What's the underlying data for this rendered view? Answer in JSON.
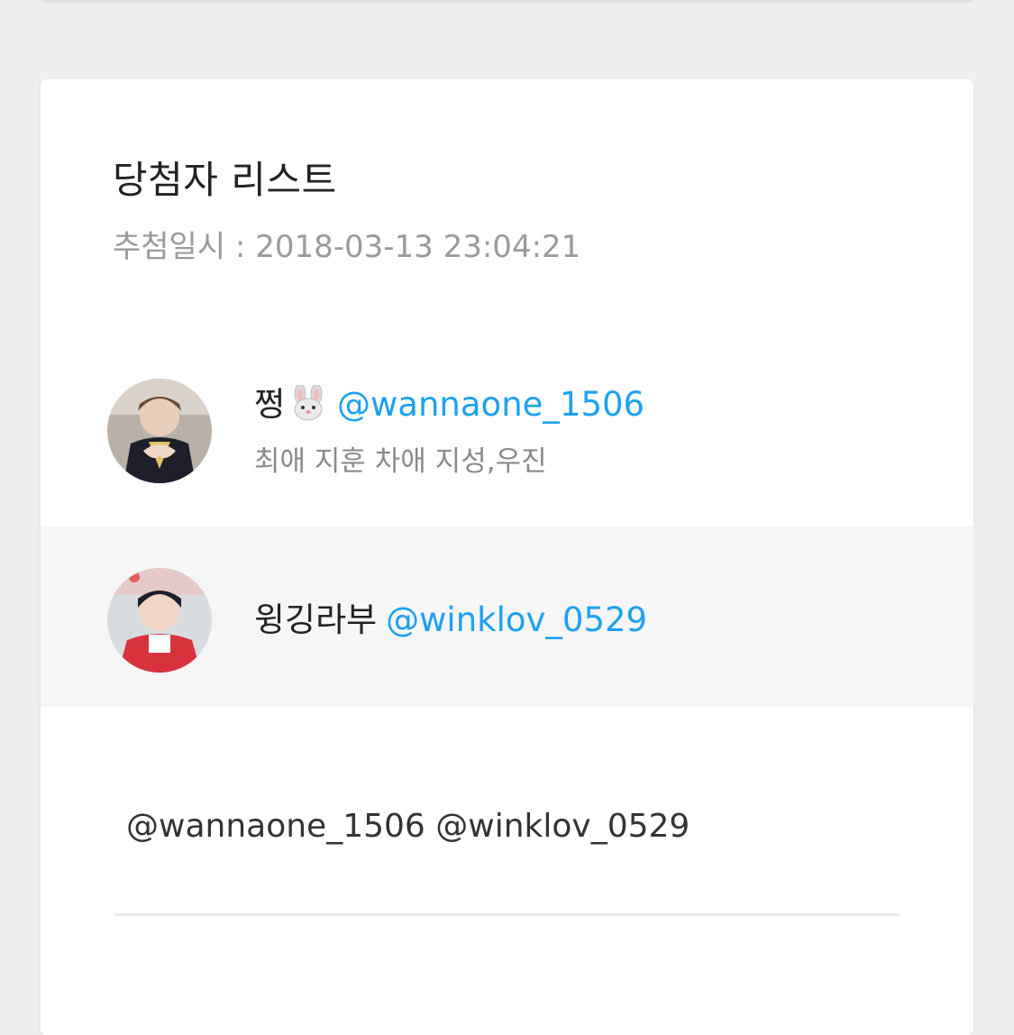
{
  "card": {
    "title": "당첨자 리스트",
    "draw_date": "추첨일시 : 2018-03-13 23:04:21"
  },
  "winners": [
    {
      "name": "쩡",
      "emoji": "rabbit-face-emoji",
      "handle": "@wannaone_1506",
      "bio": "최애 지훈 차애 지성,우진"
    },
    {
      "name": "윙깅라부",
      "handle": "@winklov_0529"
    }
  ],
  "mentions_text": "@wannaone_1506 @winklov_0529",
  "colors": {
    "handle": "#1da1f2",
    "page_bg": "#efefef",
    "highlight_row": "#f6f6f6"
  }
}
